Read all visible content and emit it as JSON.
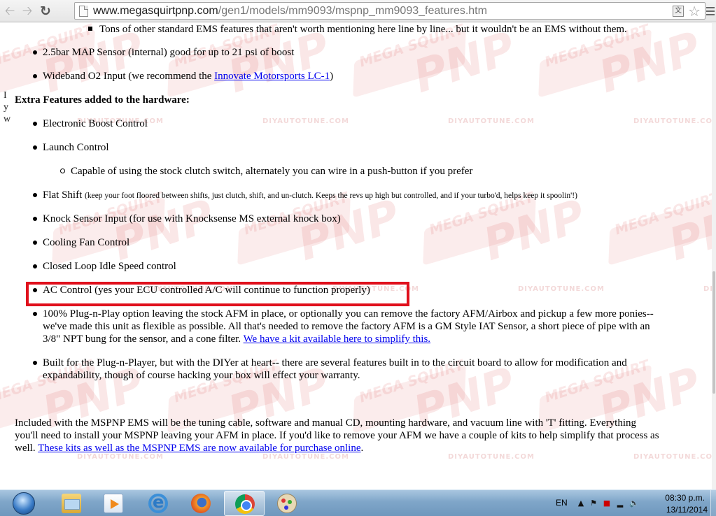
{
  "browser": {
    "url_host": "www.megasquirtpnp.com",
    "url_path": "/gen1/models/mm9093/mspnp_mm9093_features.htm"
  },
  "content": {
    "sub_item_top": "Tons of other standard EMS features that aren't worth mentioning here line by line... but it wouldn't be an EMS without them.",
    "item_map": "2.5bar MAP Sensor (internal) good for up to 21 psi of boost",
    "item_wideband_prefix": "Wideband O2 Input (we recommend the ",
    "item_wideband_link": "Innovate Motorsports LC-1",
    "item_wideband_suffix": ")",
    "left_stub": [
      "I",
      "y",
      "w"
    ],
    "extra_heading": "Extra Features added to the hardware:",
    "item_boost": "Electronic Boost Control",
    "item_launch": "Launch Control",
    "sub_launch": "Capable of using the stock clutch switch, alternately you can wire in a push-button if you prefer",
    "item_flat_main": "Flat Shift",
    "item_flat_small": "(keep your foot floored between shifts, just clutch, shift, and un-clutch.  Keeps the revs up high but controlled, and if your turbo'd, helps keep it spoolin'!)",
    "item_knock": "Knock Sensor Input (for use with Knocksense MS external knock box)",
    "item_fan": "Cooling Fan Control",
    "item_idle": "Closed Loop Idle Speed control",
    "item_ac": "AC Control (yes your ECU controlled A/C will continue to function properly)",
    "item_pnp_l1": "100% Plug-n-Play option leaving the stock AFM in place, or optionally you can remove the factory AFM/Airbox and pickup a few more ponies--",
    "item_pnp_l2": "we've made this unit as flexible as possible.  All that's needed to remove the factory AFM is a GM Style IAT Sensor, a short piece of pipe with an",
    "item_pnp_l3": "3/8\" NPT bung for the sensor, and a cone filter.  ",
    "item_pnp_link": "We have a kit available here to simplify this.",
    "item_diy_l1": "Built for the Plug-n-Player, but with the DIYer at heart-- there are several features built in to the circuit board to allow for modification and",
    "item_diy_l2": "expandability, though of course hacking your box will effect your warranty.",
    "para_l1": "Included with the MSPNP EMS will be the tuning cable, software and manual CD, mounting hardware, and vacuum line with 'T' fitting.  Everything",
    "para_l2": "you'll need to install your MSPNP leaving your AFM in place.  If you'd like to remove your AFM we have a couple of kits to help simplify that process as",
    "para_l3_prefix": "well.  ",
    "para_link": "These kits as well as the MSPNP EMS are now available for purchase online",
    "para_l3_suffix": "."
  },
  "watermark": {
    "brand": "MEGA SQUIRT",
    "logo": "PNP",
    "sub": "DIYAUTOTUNE.COM",
    "color": "#dc4646"
  },
  "highlight": {
    "color": "#e0101c"
  },
  "taskbar": {
    "language": "EN",
    "time": "08:30 p.m.",
    "date": "13/11/2014",
    "apps": [
      "windows-explorer",
      "media-center",
      "internet-explorer",
      "firefox",
      "chrome",
      "paint"
    ],
    "active_app": "chrome"
  }
}
